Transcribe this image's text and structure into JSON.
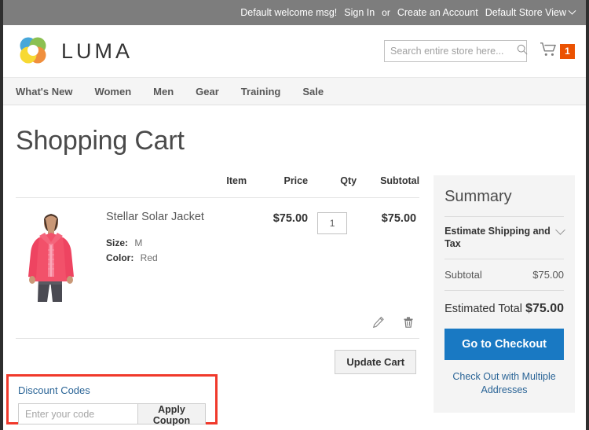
{
  "topbar": {
    "welcome": "Default welcome msg!",
    "sign_in": "Sign In",
    "or": "or",
    "create_account": "Create an Account",
    "store_view": "Default Store View"
  },
  "header": {
    "brand_name": "LUMA",
    "search_placeholder": "Search entire store here...",
    "search_value": "",
    "cart_count": "1"
  },
  "nav": {
    "items": [
      {
        "label": "What's New"
      },
      {
        "label": "Women"
      },
      {
        "label": "Men"
      },
      {
        "label": "Gear"
      },
      {
        "label": "Training"
      },
      {
        "label": "Sale"
      }
    ]
  },
  "main": {
    "page_title": "Shopping Cart",
    "table": {
      "headers": {
        "item": "Item",
        "price": "Price",
        "qty": "Qty",
        "subtotal": "Subtotal"
      },
      "rows": [
        {
          "name": "Stellar Solar Jacket",
          "price": "$75.00",
          "qty": "1",
          "subtotal": "$75.00",
          "options": [
            {
              "label": "Size:",
              "value": "M"
            },
            {
              "label": "Color:",
              "value": "Red"
            }
          ]
        }
      ]
    },
    "update_cart_label": "Update Cart",
    "discount": {
      "title": "Discount Codes",
      "input_placeholder": "Enter your code",
      "input_value": "",
      "apply_label": "Apply Coupon"
    }
  },
  "summary": {
    "title": "Summary",
    "estimate_label": "Estimate Shipping and Tax",
    "subtotal_label": "Subtotal",
    "subtotal_value": "$75.00",
    "total_label": "Estimated Total",
    "total_value": "$75.00",
    "checkout_label": "Go to Checkout",
    "multi_address_label": "Check Out with Multiple Addresses"
  },
  "colors": {
    "topbar_bg": "#7d7d7d",
    "accent_orange": "#eb5202",
    "accent_blue": "#1979c3",
    "link_blue": "#2a6496",
    "highlight_red": "#f0392b",
    "summary_bg": "#f4f4f4"
  }
}
